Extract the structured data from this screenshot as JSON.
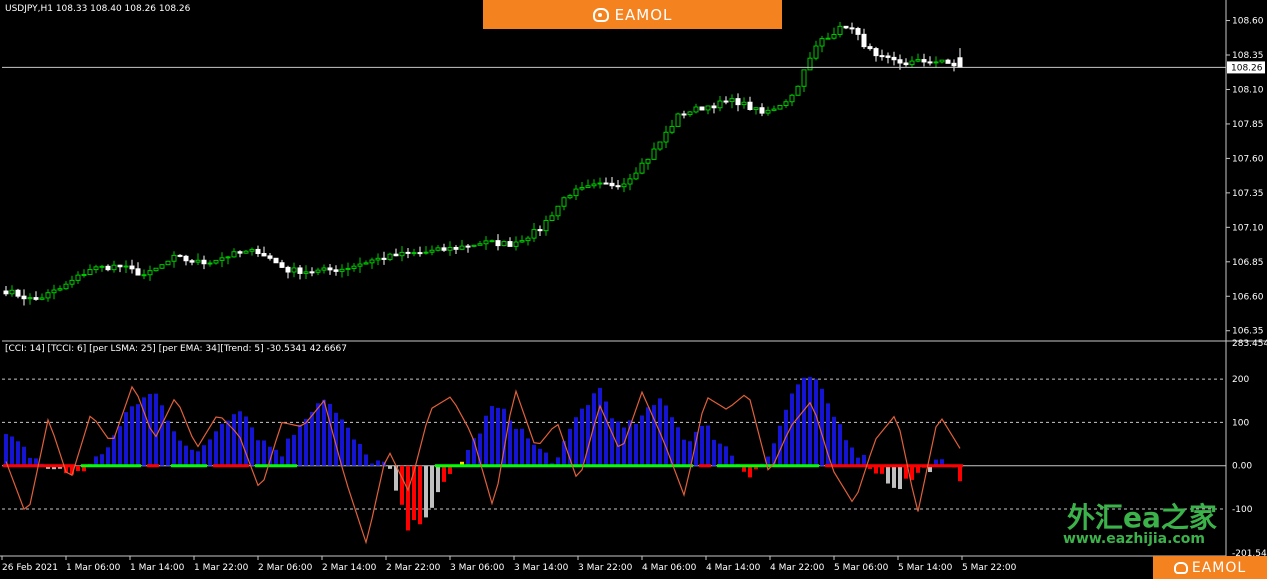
{
  "symbol_header": "USDJPY,H1  108.33 108.40 108.26 108.26",
  "indicator_header": "[CCI: 14] [TCCI: 6] [per LSMA: 25] [per EMA: 34][Trend: 5]  -30.5341 42.6667",
  "current_price_label": "108.26",
  "brand": {
    "name": "EAMOL",
    "watermark_cn": "外汇ea之家",
    "watermark_url": "www.eazhijia.com"
  },
  "colors": {
    "bull": "#00c800",
    "bear": "#ffffff",
    "cci_up": "#1414d2",
    "cci_neutral": "#c0c0c0",
    "cci_down": "#ff0000",
    "trend_up": "#00ff00",
    "trend_down": "#ff0000",
    "signal": "#ffd700",
    "tcci_line": "#e0603a",
    "brand": "#f4821f"
  },
  "chart_data": [
    {
      "type": "candlestick",
      "title": "USDJPY,H1",
      "ohlc_last": {
        "open": 108.33,
        "high": 108.4,
        "low": 108.26,
        "close": 108.26
      },
      "ylim": [
        106.29,
        108.72
      ],
      "y_ticks": [
        "108.60",
        "108.35",
        "108.10",
        "107.85",
        "107.60",
        "107.35",
        "107.10",
        "106.85",
        "106.60",
        "106.35"
      ],
      "x_ticks": [
        "26 Feb 2021",
        "1 Mar 06:00",
        "1 Mar 14:00",
        "1 Mar 22:00",
        "2 Mar 06:00",
        "2 Mar 14:00",
        "2 Mar 22:00",
        "3 Mar 06:00",
        "3 Mar 14:00",
        "3 Mar 22:00",
        "4 Mar 06:00",
        "4 Mar 14:00",
        "4 Mar 22:00",
        "5 Mar 06:00",
        "5 Mar 14:00",
        "5 Mar 22:00"
      ],
      "close_path": [
        106.64,
        106.57,
        106.66,
        106.8,
        106.82,
        106.75,
        106.88,
        106.84,
        106.9,
        106.93,
        106.79,
        106.78,
        106.8,
        106.86,
        106.9,
        106.92,
        106.95,
        106.99,
        106.98,
        107.08,
        107.34,
        107.4,
        107.42,
        107.63,
        107.92,
        107.98,
        108.02,
        107.92,
        108.05,
        108.46,
        108.57,
        108.33,
        108.29,
        108.31,
        108.27
      ],
      "volatility": 0.022,
      "current_price": 108.26
    },
    {
      "type": "histogram",
      "title": "[CCI: 14] [TCCI: 6] [per LSMA: 25] [per EMA: 34][Trend: 5]",
      "current_values": [
        -30.5341,
        42.6667
      ],
      "ylim": [
        -201.545,
        283.4545
      ],
      "y_ticks": [
        "283.4545",
        "200",
        "100",
        "0.00",
        "-100",
        "-201.545"
      ],
      "levels": [
        200,
        100,
        0,
        -100
      ],
      "cci_path": [
        70,
        30,
        -5,
        -20,
        0,
        60,
        140,
        170,
        80,
        20,
        90,
        140,
        60,
        30,
        110,
        160,
        90,
        20,
        0,
        -150,
        -100,
        -20,
        50,
        140,
        100,
        40,
        10,
        120,
        180,
        80,
        110,
        160,
        60,
        90,
        40,
        -20,
        20,
        160,
        210,
        120,
        40,
        -10,
        -50,
        -20,
        10,
        -25
      ],
      "tcci_path": [
        10,
        -120,
        110,
        -40,
        120,
        50,
        190,
        60,
        160,
        40,
        120,
        70,
        -60,
        100,
        90,
        150,
        -30,
        -180,
        40,
        -60,
        130,
        160,
        70,
        -100,
        180,
        40,
        100,
        -40,
        140,
        30,
        170,
        60,
        -70,
        160,
        130,
        170,
        -20,
        90,
        150,
        -10,
        -90,
        60,
        120,
        -110,
        120,
        40
      ],
      "trend_path": [
        -1,
        -1,
        -1,
        -1,
        1,
        1,
        1,
        -1,
        1,
        1,
        -1,
        -1,
        1,
        1,
        0,
        0,
        0,
        0,
        0,
        0,
        0,
        1,
        1,
        1,
        1,
        1,
        1,
        1,
        1,
        1,
        1,
        1,
        1,
        -1,
        1,
        1,
        1,
        1,
        1,
        -1,
        -1,
        -1,
        -1,
        -1,
        -1,
        -1
      ]
    }
  ]
}
